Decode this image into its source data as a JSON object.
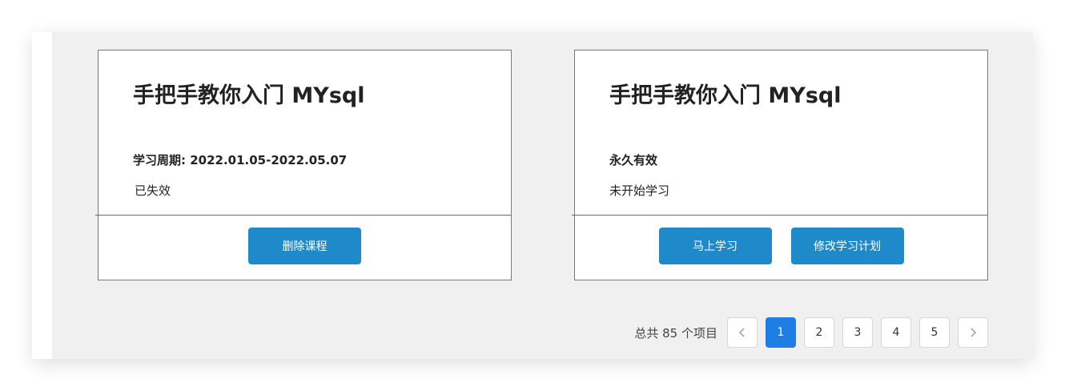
{
  "cards": [
    {
      "title": "手把手教你入门 MYsql",
      "info": "学习周期: 2022.01.05-2022.05.07",
      "status": "已失效",
      "buttons": [
        "删除课程"
      ]
    },
    {
      "title": "手把手教你入门 MYsql",
      "info": "永久有效",
      "status": "未开始学习",
      "buttons": [
        "马上学习",
        "修改学习计划"
      ]
    }
  ],
  "pagination": {
    "total": "总共 85 个项目",
    "pages": [
      "1",
      "2",
      "3",
      "4",
      "5"
    ],
    "active_page": "1"
  },
  "colors": {
    "button": "#1f8ac9",
    "active_page": "#1f7ee6"
  },
  "icons": {
    "prev": "chevron-left-icon",
    "next": "chevron-right-icon"
  }
}
